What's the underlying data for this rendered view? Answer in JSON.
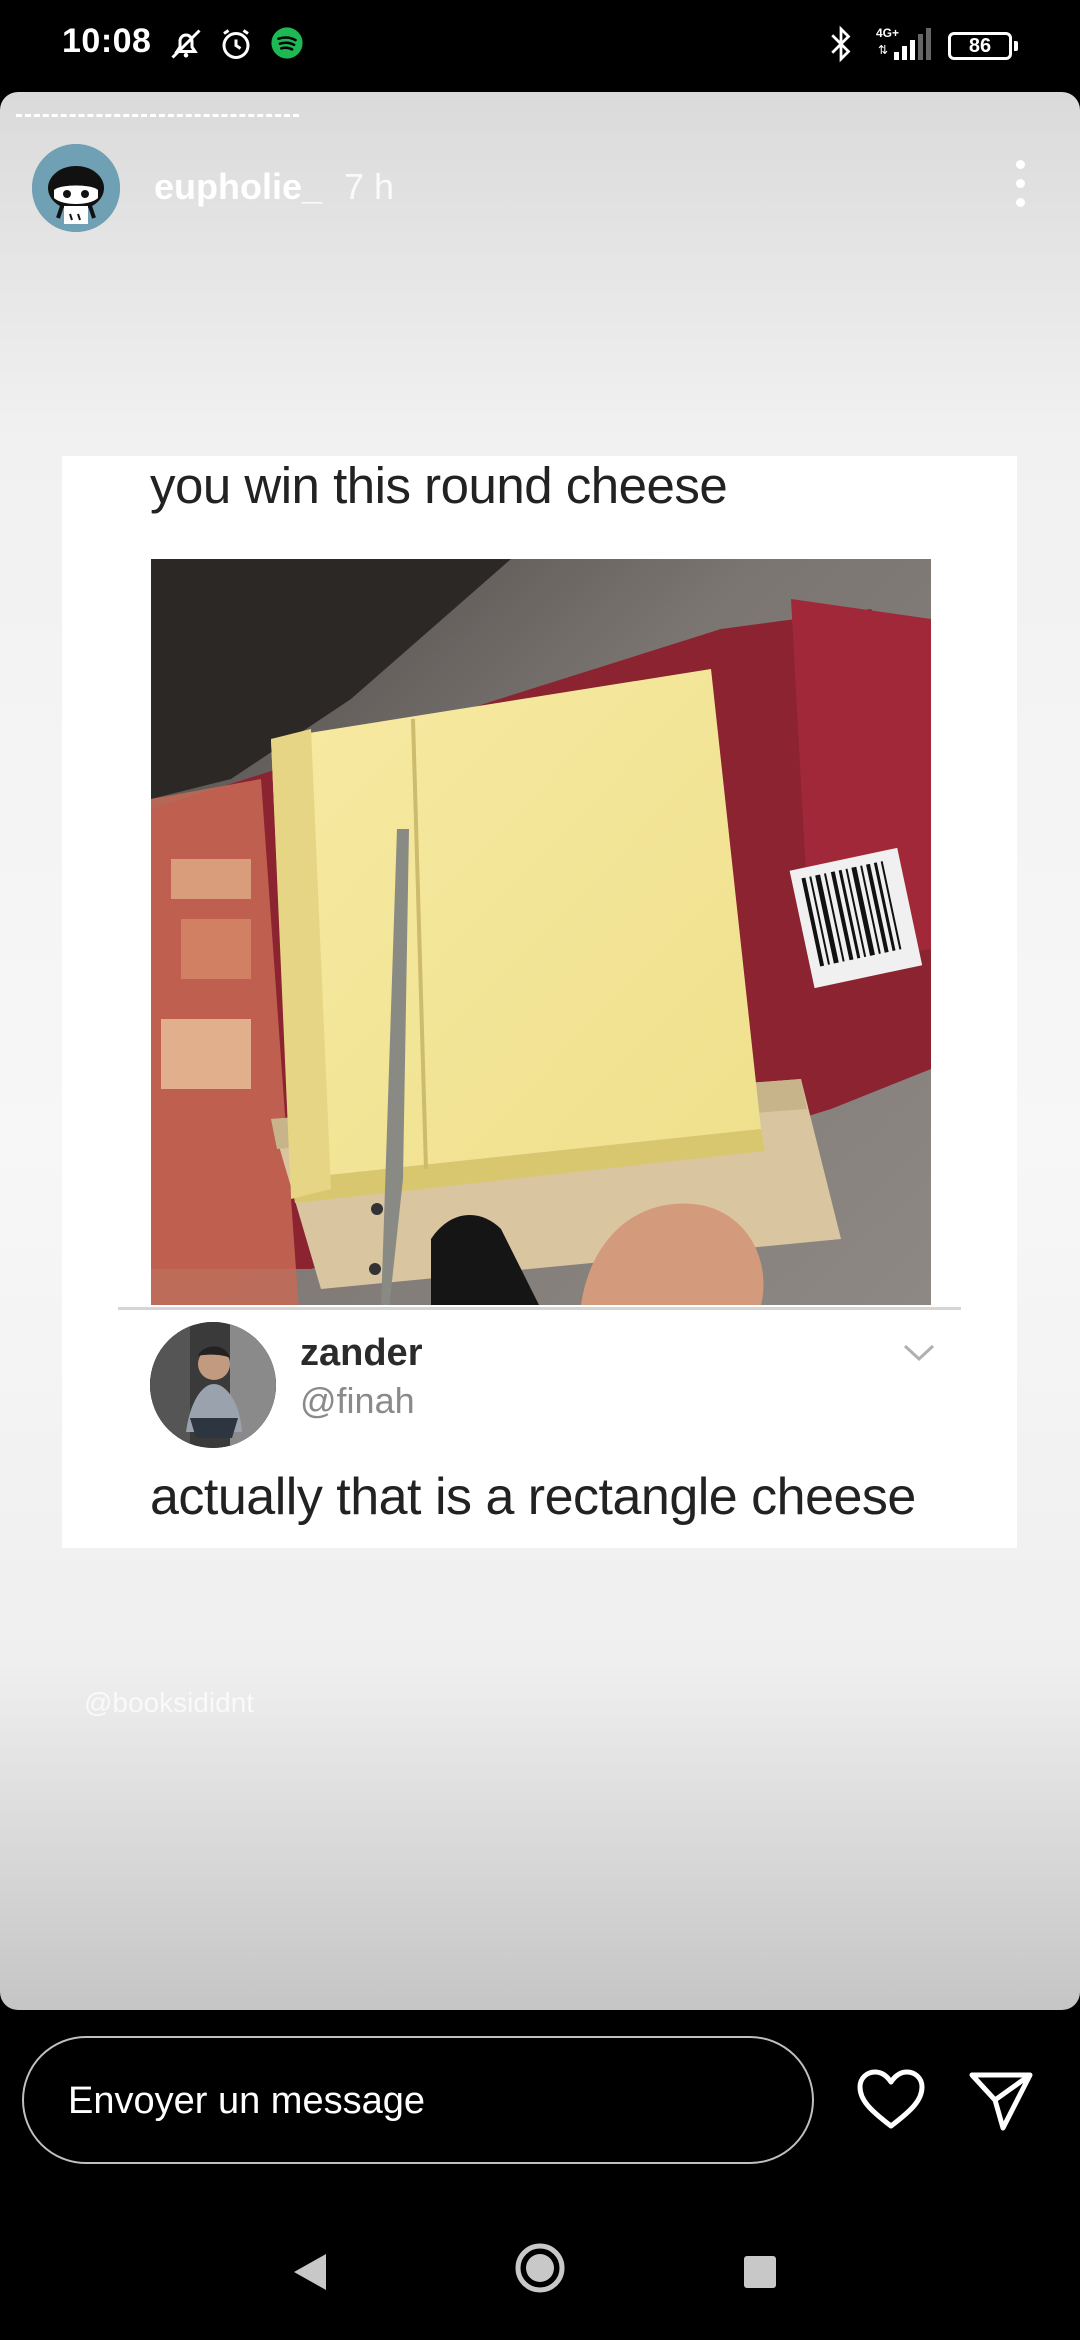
{
  "status_bar": {
    "time": "10:08",
    "network": "4G+",
    "battery": "86",
    "icons": [
      "bell-muted-icon",
      "alarm-icon",
      "spotify-icon",
      "bluetooth-icon",
      "signal-icon",
      "battery-icon"
    ]
  },
  "story": {
    "username": "eupholie_",
    "time_ago": "7 h",
    "progress": 0.27,
    "meme": {
      "caption": "you win this round cheese",
      "reply_name": "zander",
      "reply_handle": "@finah",
      "reply_text": "actually that is a rectangle cheese"
    },
    "watermark": "@booksididnt"
  },
  "message_bar": {
    "placeholder": "Envoyer un message",
    "heart_icon": "heart-icon",
    "send_icon": "send-icon"
  },
  "nav_bar": {
    "icons": [
      "back-icon",
      "home-icon",
      "recents-icon"
    ]
  },
  "colors": {
    "background": "#000000",
    "card": "#ffffff",
    "cheese": "#f3e79b",
    "wrapper_red": "#8b2330"
  }
}
